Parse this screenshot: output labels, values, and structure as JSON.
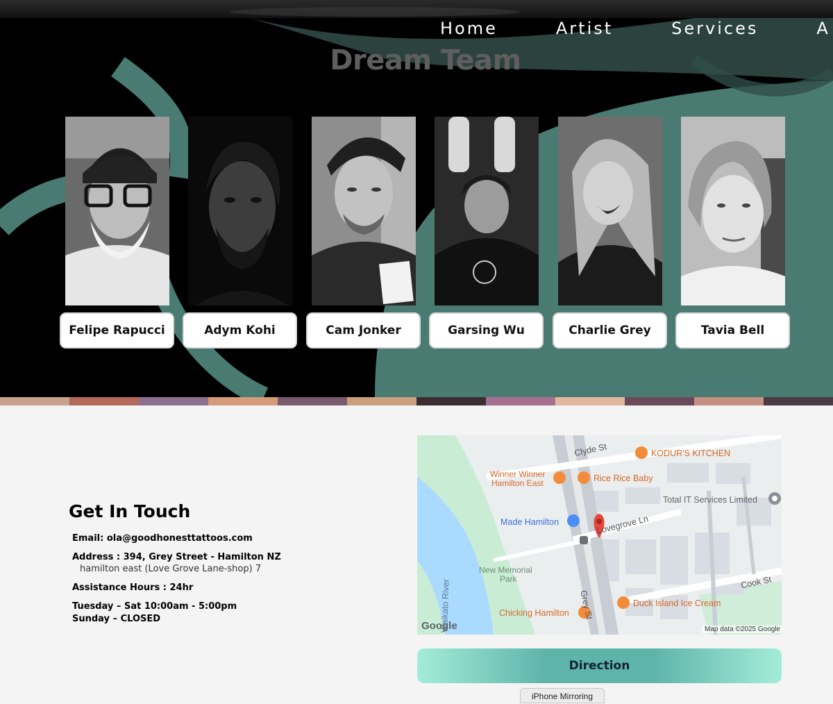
{
  "nav": {
    "items": [
      {
        "label": "Home"
      },
      {
        "label": "Artist"
      },
      {
        "label": "Services"
      },
      {
        "label": "A"
      }
    ]
  },
  "hero": {
    "title": "Dream Team",
    "artists": [
      {
        "name": "Felipe Rapucci",
        "photo": "person-photo"
      },
      {
        "name": "Adym Kohi",
        "photo": "person-photo"
      },
      {
        "name": "Cam Jonker",
        "photo": "person-photo"
      },
      {
        "name": "Garsing Wu",
        "photo": "person-photo"
      },
      {
        "name": "Charlie Grey",
        "photo": "person-photo"
      },
      {
        "name": "Tavia Bell",
        "photo": "person-photo"
      }
    ]
  },
  "contact": {
    "title": "Get In Touch",
    "email": "Email: ola@goodhonesttattoos.com",
    "address": "Address : 394, Grey Street - Hamilton NZ",
    "address_sub": "hamilton east (Love Grove Lane-shop) 7",
    "assistance": "Assistance Hours : 24hr",
    "hours_weekday": "Tuesday – Sat 10:00am - 5:00pm",
    "hours_sunday": "Sunday – CLOSED",
    "direction_label": "Direction"
  },
  "map": {
    "streets": {
      "clyde": "Clyde St",
      "lovegrove": "Lovegrove Ln",
      "grey": "Grey St",
      "cook": "Cook St",
      "river": "Waikato River"
    },
    "places": {
      "kodurs": "KODUR'S KITCHEN",
      "winner_1": "Winner Winner",
      "winner_2": "Hamilton East",
      "rice": "Rice Rice Baby",
      "total_it": "Total IT Services Limited",
      "made": "Made Hamilton",
      "memorial_1": "New Memorial",
      "memorial_2": "Park",
      "chicking": "Chicking Hamilton",
      "duck": "Duck Island Ice Cream"
    },
    "logo": "Google",
    "attribution": "Map data ©2025 Google",
    "colors": {
      "water": "#aadaff",
      "park": "#c9ecd5",
      "food_pin": "#f28c3a",
      "food_text": "#d6682a",
      "shop_pin": "#4b8ef7",
      "shop_text": "#3b6fd8",
      "marker": "#e8453c"
    }
  },
  "system": {
    "tooltip": "iPhone Mirroring"
  },
  "colors": {
    "hero_bg": "#000000",
    "teal": "#4a7b73",
    "button_gradient_mid": "#5fb4aa",
    "button_gradient_edge": "#a4ecd9"
  }
}
